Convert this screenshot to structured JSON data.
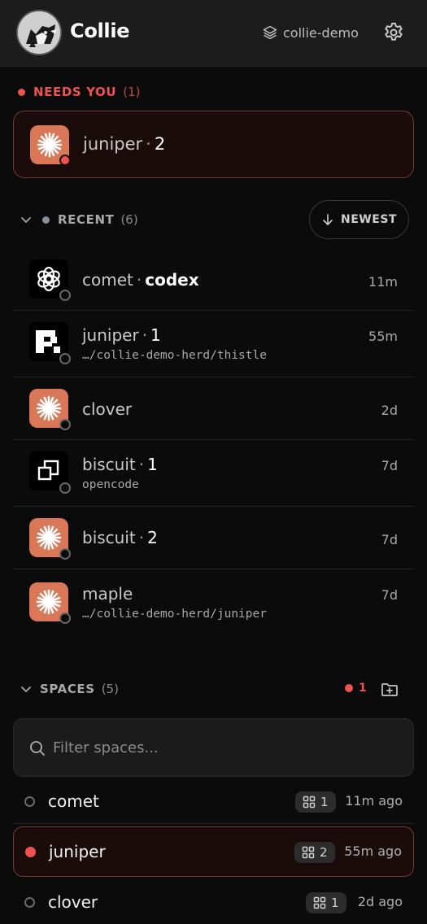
{
  "header": {
    "app_title": "Collie",
    "project": "collie-demo",
    "icons": [
      "collie-avatar",
      "layers-icon",
      "gear-icon"
    ]
  },
  "needs_you": {
    "label": "NEEDS YOU",
    "count": "(1)",
    "item": {
      "name": "juniper",
      "sep": "·",
      "tag": "2",
      "icon": "claude-icon"
    }
  },
  "recent": {
    "label": "RECENT",
    "count": "(6)",
    "sort_label": "NEWEST",
    "items": [
      {
        "name": "comet",
        "sep": "·",
        "tag": "codex",
        "sub": "",
        "time": "11m",
        "icon": "openai-icon"
      },
      {
        "name": "juniper",
        "sep": "·",
        "tag": "1",
        "sub": "…/collie-demo-herd/thistle",
        "time": "55m",
        "icon": "pixel-p-icon"
      },
      {
        "name": "clover",
        "sep": "",
        "tag": "",
        "sub": "",
        "time": "2d",
        "icon": "claude-icon"
      },
      {
        "name": "biscuit",
        "sep": "·",
        "tag": "1",
        "sub": "opencode",
        "time": "7d",
        "icon": "opencode-icon"
      },
      {
        "name": "biscuit",
        "sep": "·",
        "tag": "2",
        "sub": "",
        "time": "7d",
        "icon": "claude-icon"
      },
      {
        "name": "maple",
        "sep": "",
        "tag": "",
        "sub": "…/collie-demo-herd/juniper",
        "time": "7d",
        "icon": "claude-icon"
      }
    ]
  },
  "spaces": {
    "label": "SPACES",
    "count": "(5)",
    "alert_count": "1",
    "filter_placeholder": "Filter spaces...",
    "items": [
      {
        "name": "comet",
        "badge": "1",
        "time": "11m ago",
        "active": false
      },
      {
        "name": "juniper",
        "badge": "2",
        "time": "55m ago",
        "active": true
      },
      {
        "name": "clover",
        "badge": "1",
        "time": "2d ago",
        "active": false
      }
    ]
  },
  "colors": {
    "accent_red": "#ef5350",
    "claude_orange": "#da7756"
  }
}
